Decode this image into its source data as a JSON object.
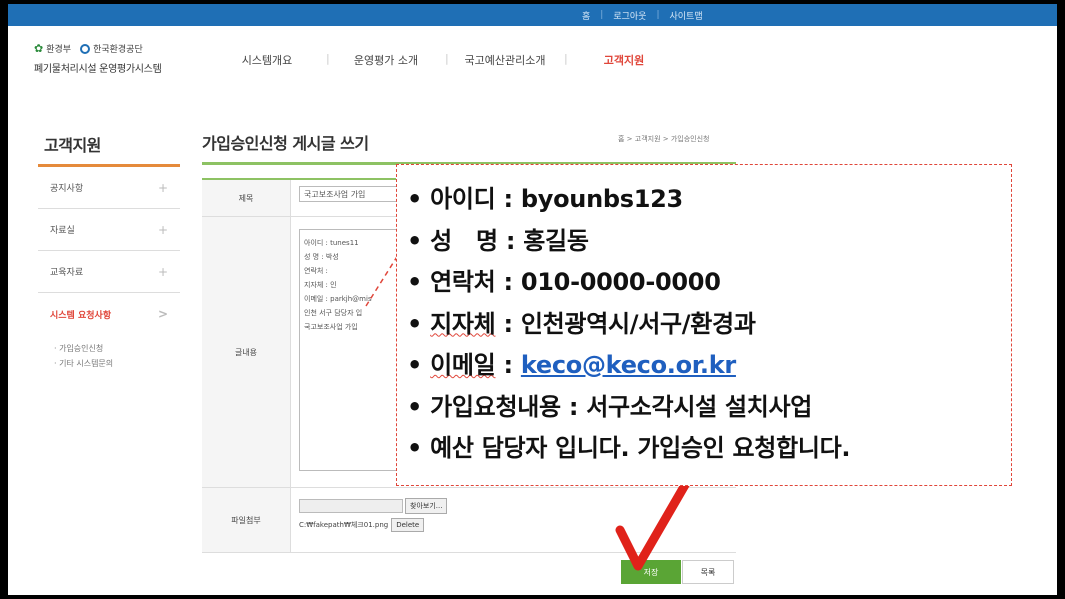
{
  "top_links": [
    "홈",
    "로그아웃",
    "사이트맵"
  ],
  "logo": {
    "ministry": "환경부",
    "agency": "한국환경공단",
    "system_name": "폐기물처리시설 운영평가시스템"
  },
  "gnb": [
    "시스템개요",
    "운영평가 소개",
    "국고예산관리소개",
    "고객지원"
  ],
  "gnb_active": "고객지원",
  "sidebar": {
    "title": "고객지원",
    "items": [
      {
        "label": "공지사항",
        "icon": "+"
      },
      {
        "label": "자료실",
        "icon": "+"
      },
      {
        "label": "교육자료",
        "icon": "+"
      },
      {
        "label": "시스템 요청사항",
        "icon": ">"
      }
    ],
    "sub_items": [
      "· 가입승인신청",
      "· 기타 시스템문의"
    ]
  },
  "page": {
    "title": "가입승인신청 게시글 쓰기",
    "breadcrumb": "홈 > 고객지원 > 가입승인신청"
  },
  "form": {
    "subject_label": "제목",
    "subject_value": "국고보조사업 가입",
    "content_label": "글내용",
    "content_lines": [
      "아이디 : tunes11",
      "성  명 : 박성",
      "연락처 :",
      "지자체 : 인",
      "이메일 : parkjh@mis",
      "인천 서구 담당자 입",
      "국고보조사업 가입"
    ],
    "file_label": "파일첨부",
    "browse_label": "찾아보기...",
    "file_path": "C:₩fakepath₩체크01.png",
    "delete_label": "Delete",
    "save_label": "저장",
    "list_label": "목록"
  },
  "callout": {
    "bullet": "•",
    "lines": [
      {
        "key": "아이디",
        "sep": " : ",
        "value": "byounbs123"
      },
      {
        "key": "성   명",
        "sep": " : ",
        "value": "홍길동"
      },
      {
        "key": "연락처",
        "sep": " : ",
        "value": "010-0000-0000"
      },
      {
        "key": "지자체",
        "sep": " : ",
        "value": "인천광역시/서구/환경과"
      },
      {
        "key": "이메일",
        "sep": " : ",
        "value": "keco@keco.or.kr"
      },
      {
        "key": "가입요청내용",
        "sep": " : ",
        "value": "서구소각시설 설치사업"
      },
      {
        "key": "예산 담당자 입니다. 가입승인 요청합니다.",
        "sep": "",
        "value": ""
      }
    ]
  },
  "colors": {
    "topbar": "#1f6fb5",
    "accent_red": "#e0463a",
    "green": "#5aa535",
    "link": "#1f5fbf"
  }
}
